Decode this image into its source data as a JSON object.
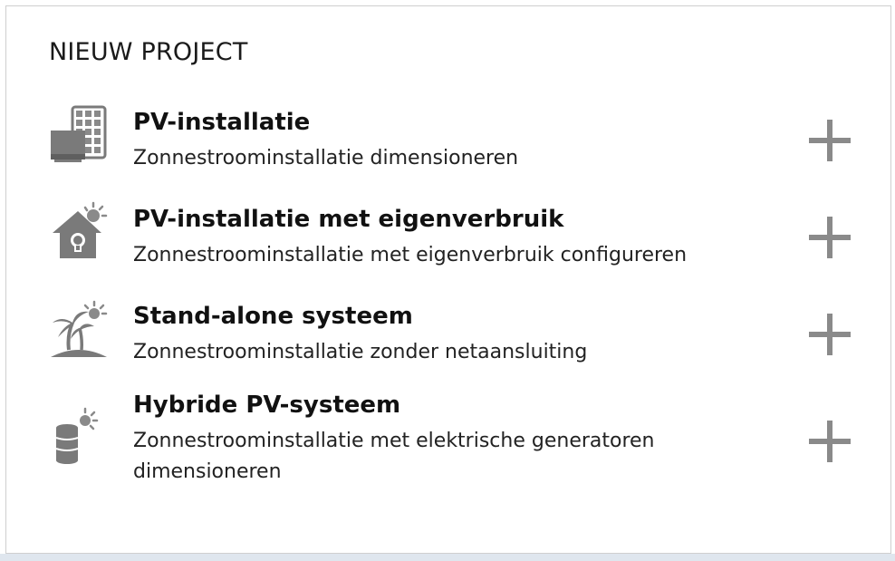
{
  "panel": {
    "title": "NIEUW PROJECT"
  },
  "items": [
    {
      "title": "PV-installatie",
      "description": "Zonnestroominstallatie dimensioneren",
      "icon": "solar-panel-icon"
    },
    {
      "title": "PV-installatie met eigenverbruik",
      "description": "Zonnestroominstallatie met eigenverbruik configureren",
      "icon": "house-sun-icon"
    },
    {
      "title": "Stand-alone systeem",
      "description": "Zonnestroominstallatie zonder netaansluiting",
      "icon": "island-palm-sun-icon"
    },
    {
      "title": "Hybride PV-systeem",
      "description": "Zonnestroominstallatie met elektrische generatoren dimensioneren",
      "icon": "generator-sun-icon"
    }
  ],
  "colors": {
    "icon_gray": "#7a7a7a",
    "plus_gray": "#8a8a8a",
    "border": "#cfcfcf"
  }
}
